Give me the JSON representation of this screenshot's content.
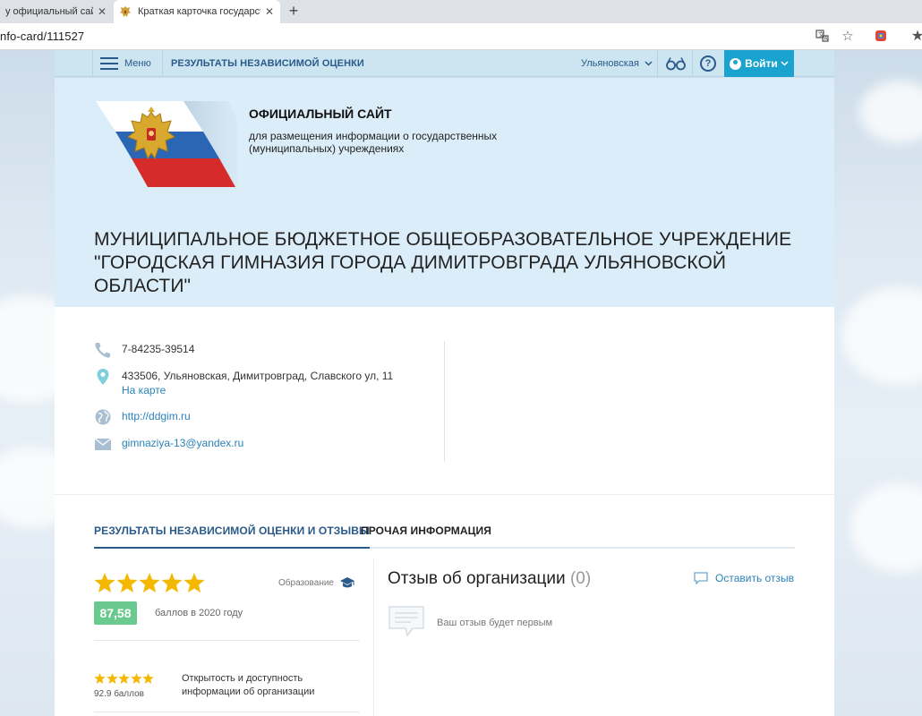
{
  "browser": {
    "tabs": [
      {
        "title": "у официальный сайт –",
        "active": false
      },
      {
        "title": "Краткая карточка государствен",
        "active": true
      }
    ],
    "new_tab": "+",
    "close_glyph": "✕",
    "url": "nfo-card/111527"
  },
  "topnav": {
    "menu_label": "Меню",
    "section_title": "РЕЗУЛЬТАТЫ НЕЗАВИСИМОЙ ОЦЕНКИ",
    "region": "Ульяновская",
    "help": "?",
    "login": "Войти"
  },
  "hero": {
    "official_title": "ОФИЦИАЛЬНЫЙ САЙТ",
    "official_subtitle": "для размещения информации о государственных (муниципальных) учреждениях",
    "org_name": "МУНИЦИПАЛЬНОЕ БЮДЖЕТНОЕ ОБЩЕОБРАЗОВАТЕЛЬНОЕ УЧРЕЖДЕНИЕ \"ГОРОДСКАЯ ГИМНАЗИЯ ГОРОДА ДИМИТРОВГРАДА УЛЬЯНОВСКОЙ ОБЛАСТИ\""
  },
  "contacts": {
    "phone": "7-84235-39514",
    "address": "433506, Ульяновская, Димитровград, Славского ул, 11",
    "map_link": "На карте",
    "website": "http://ddgim.ru",
    "email": "gimnaziya-13@yandex.ru"
  },
  "tabs": {
    "results": "РЕЗУЛЬТАТЫ НЕЗАВИСИМОЙ ОЦЕНКИ И ОТЗЫВЫ",
    "other": "ПРОЧАЯ ИНФОРМАЦИЯ"
  },
  "rating": {
    "stars": 5,
    "category": "Образование",
    "score": "87,58",
    "score_text": "баллов в 2020 году",
    "criteria": [
      {
        "stars": 5,
        "score": "92.9 баллов",
        "label": "Открытость и доступность информации об организации"
      }
    ]
  },
  "reviews": {
    "title": "Отзыв об организации",
    "count": "(0)",
    "leave_button": "Оставить отзыв",
    "empty_text": "Ваш отзыв будет первым"
  },
  "colors": {
    "accent": "#2a5a8a",
    "link": "#2a82b8",
    "login_bg": "#1ba3cf",
    "score_bg": "#69c98e",
    "star": "#f5b800",
    "hero_bg": "#dbedf8"
  }
}
